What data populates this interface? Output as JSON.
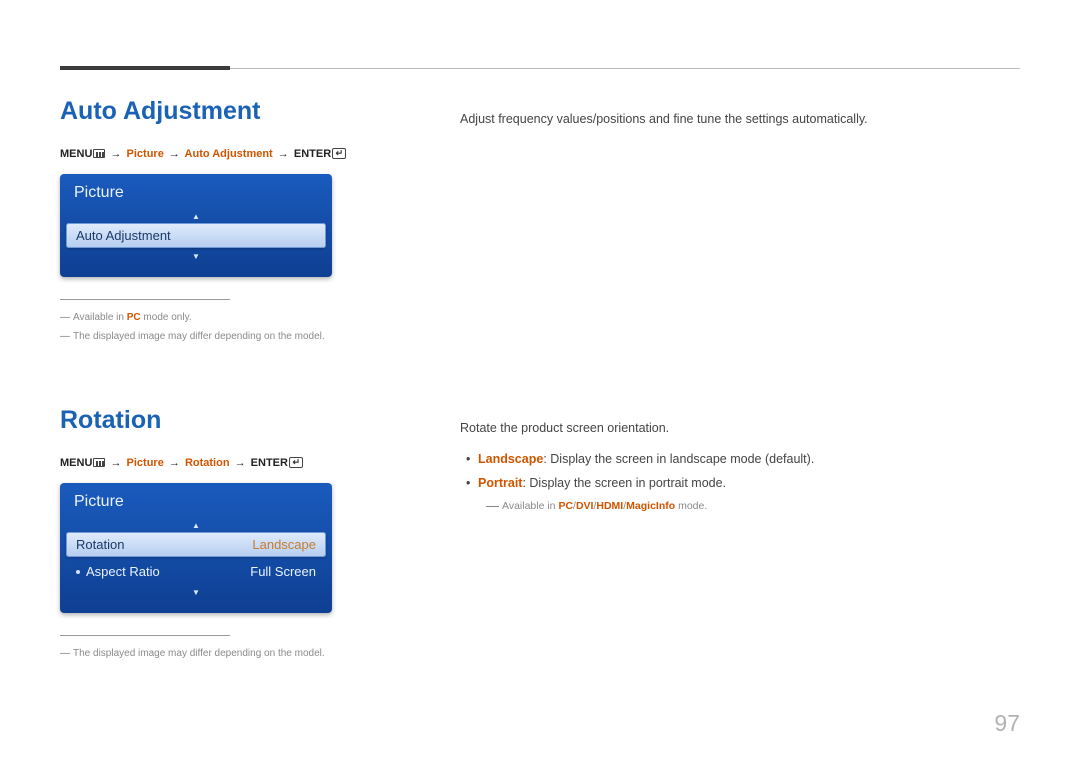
{
  "pageNumber": "97",
  "section1": {
    "heading": "Auto Adjustment",
    "breadcrumb": {
      "menu": "MENU",
      "p1": "Picture",
      "p2": "Auto Adjustment",
      "enter": "ENTER"
    },
    "osd": {
      "title": "Picture",
      "selectedItem": "Auto Adjustment"
    },
    "footnotes": {
      "f1_pre": "Available in ",
      "f1_mode": "PC",
      "f1_post": " mode only.",
      "f2": "The displayed image may differ depending on the model."
    },
    "description": "Adjust frequency values/positions and fine tune the settings automatically."
  },
  "section2": {
    "heading": "Rotation",
    "breadcrumb": {
      "menu": "MENU",
      "p1": "Picture",
      "p2": "Rotation",
      "enter": "ENTER"
    },
    "osd": {
      "title": "Picture",
      "rows": [
        {
          "label": "Rotation",
          "value": "Landscape",
          "selected": true,
          "dot": false
        },
        {
          "label": "Aspect Ratio",
          "value": "Full Screen",
          "selected": false,
          "dot": true
        }
      ]
    },
    "footnotes": {
      "f1": "The displayed image may differ depending on the model."
    },
    "description": "Rotate the product screen orientation.",
    "bullets": [
      {
        "term": "Landscape",
        "text": ": Display the screen in landscape mode (default)."
      },
      {
        "term": "Portrait",
        "text": ": Display the screen in portrait mode."
      }
    ],
    "subnote": {
      "pre": "Available in ",
      "modes": [
        "PC",
        "DVI",
        "HDMI",
        "MagicInfo"
      ],
      "post": " mode."
    }
  }
}
